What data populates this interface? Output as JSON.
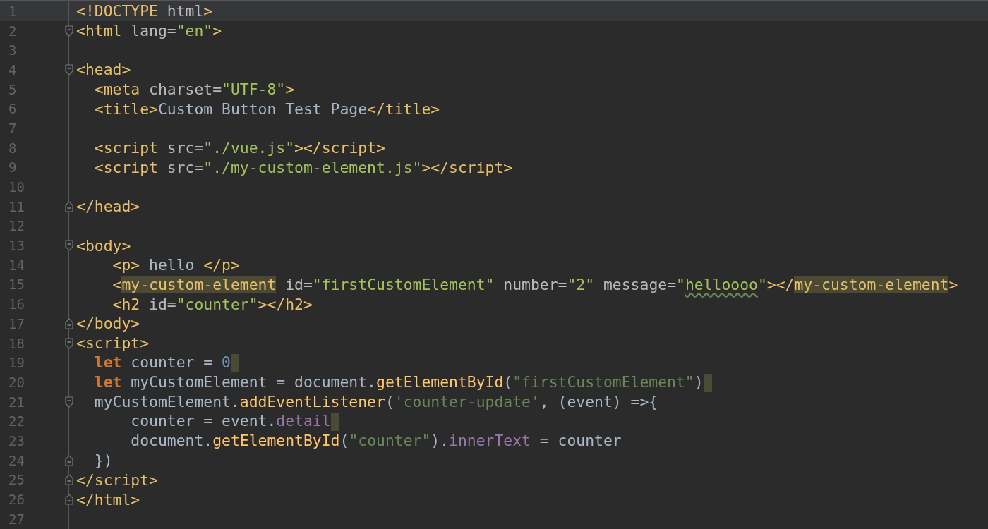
{
  "editor": {
    "lines": [
      {
        "number": "1",
        "current": true,
        "tokens": [
          {
            "text": "<!DOCTYPE",
            "kind": "tag"
          },
          {
            "text": " html",
            "kind": "attr"
          },
          {
            "text": ">",
            "kind": "tag"
          }
        ]
      },
      {
        "number": "2",
        "fold_start": true,
        "tokens": [
          {
            "text": "<html",
            "kind": "tag"
          },
          {
            "text": " lang=",
            "kind": "attr"
          },
          {
            "text": "\"en\"",
            "kind": "str"
          },
          {
            "text": ">",
            "kind": "tag"
          }
        ]
      },
      {
        "number": "3"
      },
      {
        "number": "4",
        "fold_start": true,
        "tokens": [
          {
            "text": "<head>",
            "kind": "tag"
          }
        ]
      },
      {
        "number": "5",
        "tokens": [
          {
            "text": "  <meta",
            "kind": "tag"
          },
          {
            "text": " charset=",
            "kind": "attr"
          },
          {
            "text": "\"UTF-8\"",
            "kind": "str"
          },
          {
            "text": ">",
            "kind": "tag"
          }
        ]
      },
      {
        "number": "6",
        "tokens": [
          {
            "text": "  <title>",
            "kind": "tag"
          },
          {
            "text": "Custom Button Test Page",
            "kind": "text"
          },
          {
            "text": "</title>",
            "kind": "tag"
          }
        ]
      },
      {
        "number": "7"
      },
      {
        "number": "8",
        "tokens": [
          {
            "text": "  <script",
            "kind": "tag"
          },
          {
            "text": " src=",
            "kind": "attr"
          },
          {
            "text": "\"./vue.js\"",
            "kind": "str"
          },
          {
            "text": "></script>",
            "kind": "tag"
          }
        ]
      },
      {
        "number": "9",
        "tokens": [
          {
            "text": "  <script",
            "kind": "tag"
          },
          {
            "text": " src=",
            "kind": "attr"
          },
          {
            "text": "\"./my-custom-element.js\"",
            "kind": "str"
          },
          {
            "text": "></script>",
            "kind": "tag"
          }
        ]
      },
      {
        "number": "10"
      },
      {
        "number": "11",
        "fold_end": true,
        "tokens": [
          {
            "text": "</head>",
            "kind": "tag"
          }
        ]
      },
      {
        "number": "12"
      },
      {
        "number": "13",
        "fold_start": true,
        "tokens": [
          {
            "text": "<body>",
            "kind": "tag"
          }
        ]
      },
      {
        "number": "14",
        "tokens": [
          {
            "text": "    <p>",
            "kind": "tag"
          },
          {
            "text": " hello ",
            "kind": "text"
          },
          {
            "text": "</p>",
            "kind": "tag"
          }
        ]
      },
      {
        "number": "15",
        "tokens": [
          {
            "text": "    <",
            "kind": "tag"
          },
          {
            "text": "my-custom-element",
            "kind": "tag",
            "highlight": true
          },
          {
            "text": " id=",
            "kind": "attr"
          },
          {
            "text": "\"firstCustomElement\"",
            "kind": "str"
          },
          {
            "text": " number=",
            "kind": "attr"
          },
          {
            "text": "\"2\"",
            "kind": "str"
          },
          {
            "text": " message=",
            "kind": "attr"
          },
          {
            "text": "\"",
            "kind": "str"
          },
          {
            "text": "helloooo",
            "kind": "str",
            "squiggle": true
          },
          {
            "text": "\"",
            "kind": "str"
          },
          {
            "text": "></",
            "kind": "tag"
          },
          {
            "text": "my-custom-element",
            "kind": "tag",
            "highlight": true
          },
          {
            "text": ">",
            "kind": "tag"
          }
        ]
      },
      {
        "number": "16",
        "tokens": [
          {
            "text": "    <h2",
            "kind": "tag"
          },
          {
            "text": " id=",
            "kind": "attr"
          },
          {
            "text": "\"counter\"",
            "kind": "str"
          },
          {
            "text": "></h2>",
            "kind": "tag"
          }
        ]
      },
      {
        "number": "17",
        "fold_end": true,
        "tokens": [
          {
            "text": "</body>",
            "kind": "tag"
          }
        ]
      },
      {
        "number": "18",
        "fold_start": true,
        "tokens": [
          {
            "text": "<script>",
            "kind": "tag"
          }
        ]
      },
      {
        "number": "19",
        "end_marker": true,
        "tokens": [
          {
            "text": "  let",
            "kind": "keyword"
          },
          {
            "text": " counter = ",
            "kind": "plain"
          },
          {
            "text": "0",
            "kind": "num"
          }
        ]
      },
      {
        "number": "20",
        "end_marker": true,
        "tokens": [
          {
            "text": "  let",
            "kind": "keyword"
          },
          {
            "text": " myCustomElement = document.",
            "kind": "plain"
          },
          {
            "text": "getElementById",
            "kind": "fn"
          },
          {
            "text": "(",
            "kind": "plain"
          },
          {
            "text": "\"firstCustomElement\"",
            "kind": "jsstr"
          },
          {
            "text": ")",
            "kind": "plain"
          }
        ]
      },
      {
        "number": "21",
        "fold_start": true,
        "tokens": [
          {
            "text": "  myCustomElement.",
            "kind": "plain"
          },
          {
            "text": "addEventListener",
            "kind": "fn"
          },
          {
            "text": "(",
            "kind": "plain"
          },
          {
            "text": "'counter-update'",
            "kind": "jsstr"
          },
          {
            "text": ", (event) =>{",
            "kind": "plain"
          }
        ]
      },
      {
        "number": "22",
        "end_marker": true,
        "tokens": [
          {
            "text": "      counter = event.",
            "kind": "plain"
          },
          {
            "text": "detail",
            "kind": "prop"
          }
        ]
      },
      {
        "number": "23",
        "tokens": [
          {
            "text": "      document.",
            "kind": "plain"
          },
          {
            "text": "getElementById",
            "kind": "fn"
          },
          {
            "text": "(",
            "kind": "plain"
          },
          {
            "text": "\"counter\"",
            "kind": "jsstr"
          },
          {
            "text": ").",
            "kind": "plain"
          },
          {
            "text": "innerText",
            "kind": "prop"
          },
          {
            "text": " = counter",
            "kind": "plain"
          }
        ]
      },
      {
        "number": "24",
        "fold_end": true,
        "tokens": [
          {
            "text": "  })",
            "kind": "plain"
          }
        ]
      },
      {
        "number": "25",
        "fold_end": true,
        "tokens": [
          {
            "text": "</script>",
            "kind": "tag"
          }
        ]
      },
      {
        "number": "26",
        "fold_end": true,
        "tokens": [
          {
            "text": "</html>",
            "kind": "tag"
          }
        ]
      },
      {
        "number": "27"
      }
    ]
  }
}
